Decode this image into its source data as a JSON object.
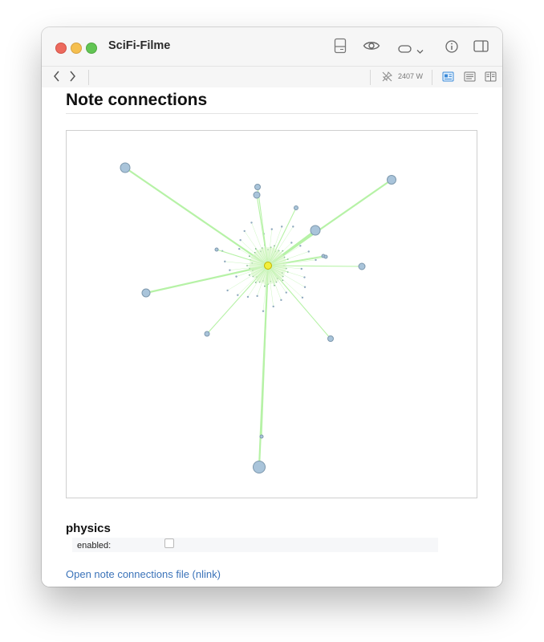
{
  "window": {
    "title": "SciFi-Filme",
    "toolbar": {
      "word_count": "2407 W",
      "icons": [
        "layout-icon",
        "eye-icon",
        "pill-toggle-icon",
        "chevron-down-icon",
        "info-icon",
        "sidebar-icon"
      ],
      "view_modes": [
        "preview-mode-icon",
        "text-mode-icon",
        "split-mode-icon"
      ],
      "active_view_mode": "preview-mode-icon"
    }
  },
  "page": {
    "heading": "Note connections",
    "graph": {
      "edge_color": "#b6f2a6",
      "node_color": "#a9c4da",
      "center_color": "#f2ef3c"
    },
    "physics": {
      "heading": "physics",
      "enabled_label": "enabled:",
      "enabled": false
    },
    "link_text": "Open note connections file (nlink)"
  },
  "colors": {
    "accent": "#3b73b9",
    "close": "#ed6a5e",
    "minimize": "#f5bf4f",
    "maximize": "#62c554"
  }
}
